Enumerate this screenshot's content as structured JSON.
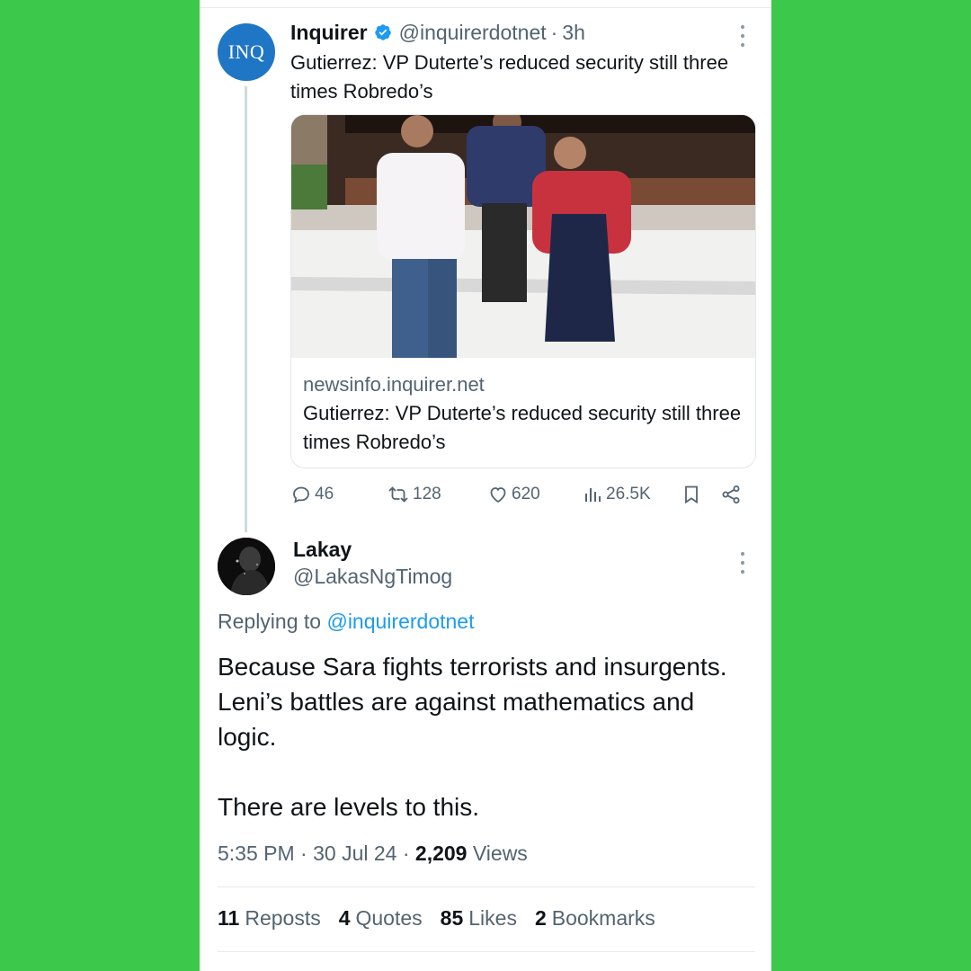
{
  "parent_tweet": {
    "avatar_text": "INQ",
    "display_name": "Inquirer",
    "handle": "@inquirerdotnet",
    "separator": "·",
    "time": "3h",
    "text": "Gutierrez: VP Duterte’s reduced security still three times Robredo’s",
    "card": {
      "domain": "newsinfo.inquirer.net",
      "title": "Gutierrez: VP Duterte’s reduced security still three times Robredo’s"
    },
    "actions": {
      "replies": "46",
      "reposts": "128",
      "likes": "620",
      "views": "26.5K"
    }
  },
  "reply_tweet": {
    "display_name": "Lakay",
    "handle": "@LakasNgTimog",
    "replying_prefix": "Replying to",
    "replying_to": "@inquirerdotnet",
    "body_line1": "Because Sara fights terrorists and insurgents. Leni’s battles are against mathematics and logic.",
    "body_line2": "There are levels to this.",
    "meta": {
      "time": "5:35 PM",
      "date": "30 Jul 24",
      "views_count": "2,209",
      "views_label": "Views",
      "separator": "·"
    },
    "stats": [
      {
        "count": "11",
        "label": "Reposts"
      },
      {
        "count": "4",
        "label": "Quotes"
      },
      {
        "count": "85",
        "label": "Likes"
      },
      {
        "count": "2",
        "label": "Bookmarks"
      }
    ]
  },
  "colors": {
    "background": "#3cc84a",
    "link_blue": "#1d9bf0",
    "secondary_text": "#536471",
    "inq_blue": "#1f76c5"
  },
  "icons": [
    "verified-badge-icon",
    "more-icon",
    "reply-icon",
    "repost-icon",
    "like-icon",
    "views-icon",
    "bookmark-icon",
    "share-icon"
  ]
}
